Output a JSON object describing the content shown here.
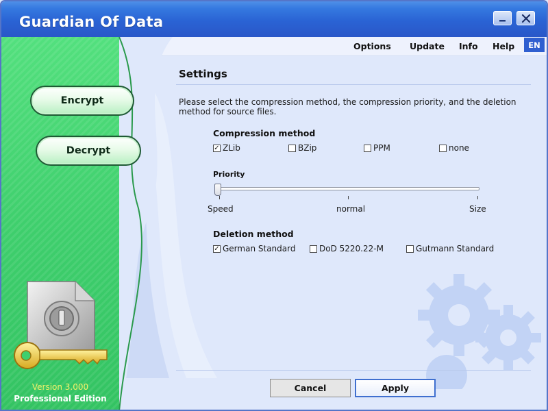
{
  "window": {
    "title": "Guardian Of Data",
    "controls": [
      "minimize-icon",
      "close-icon"
    ]
  },
  "menu": {
    "items": [
      "Options",
      "Update",
      "Info",
      "Help"
    ],
    "language": "EN"
  },
  "sidebar": {
    "buttons": [
      "Encrypt",
      "Decrypt"
    ],
    "version": "Version 3.000",
    "edition": "Professional Edition"
  },
  "settings": {
    "title": "Settings",
    "description": "Please select the compression method, the compression priority, and the deletion method for source files.",
    "compression": {
      "label": "Compression method",
      "options": [
        {
          "label": "ZLib",
          "checked": true
        },
        {
          "label": "BZip",
          "checked": false
        },
        {
          "label": "PPM",
          "checked": false
        },
        {
          "label": "none",
          "checked": false
        }
      ]
    },
    "priority": {
      "label": "Priority",
      "tick_labels": [
        "Speed",
        "normal",
        "Size"
      ],
      "level": 0
    },
    "deletion": {
      "label": "Deletion method",
      "options": [
        {
          "label": "German Standard",
          "checked": true
        },
        {
          "label": "DoD 5220.22-M",
          "checked": false
        },
        {
          "label": "Gutmann Standard",
          "checked": false
        }
      ]
    }
  },
  "footer": {
    "cancel": "Cancel",
    "apply": "Apply"
  },
  "colors": {
    "titlebar": "#2a63d4",
    "sidebar_green": "#3fcf6d",
    "content_bg": "#dfe8fb",
    "accent": "#2f5fd0"
  }
}
